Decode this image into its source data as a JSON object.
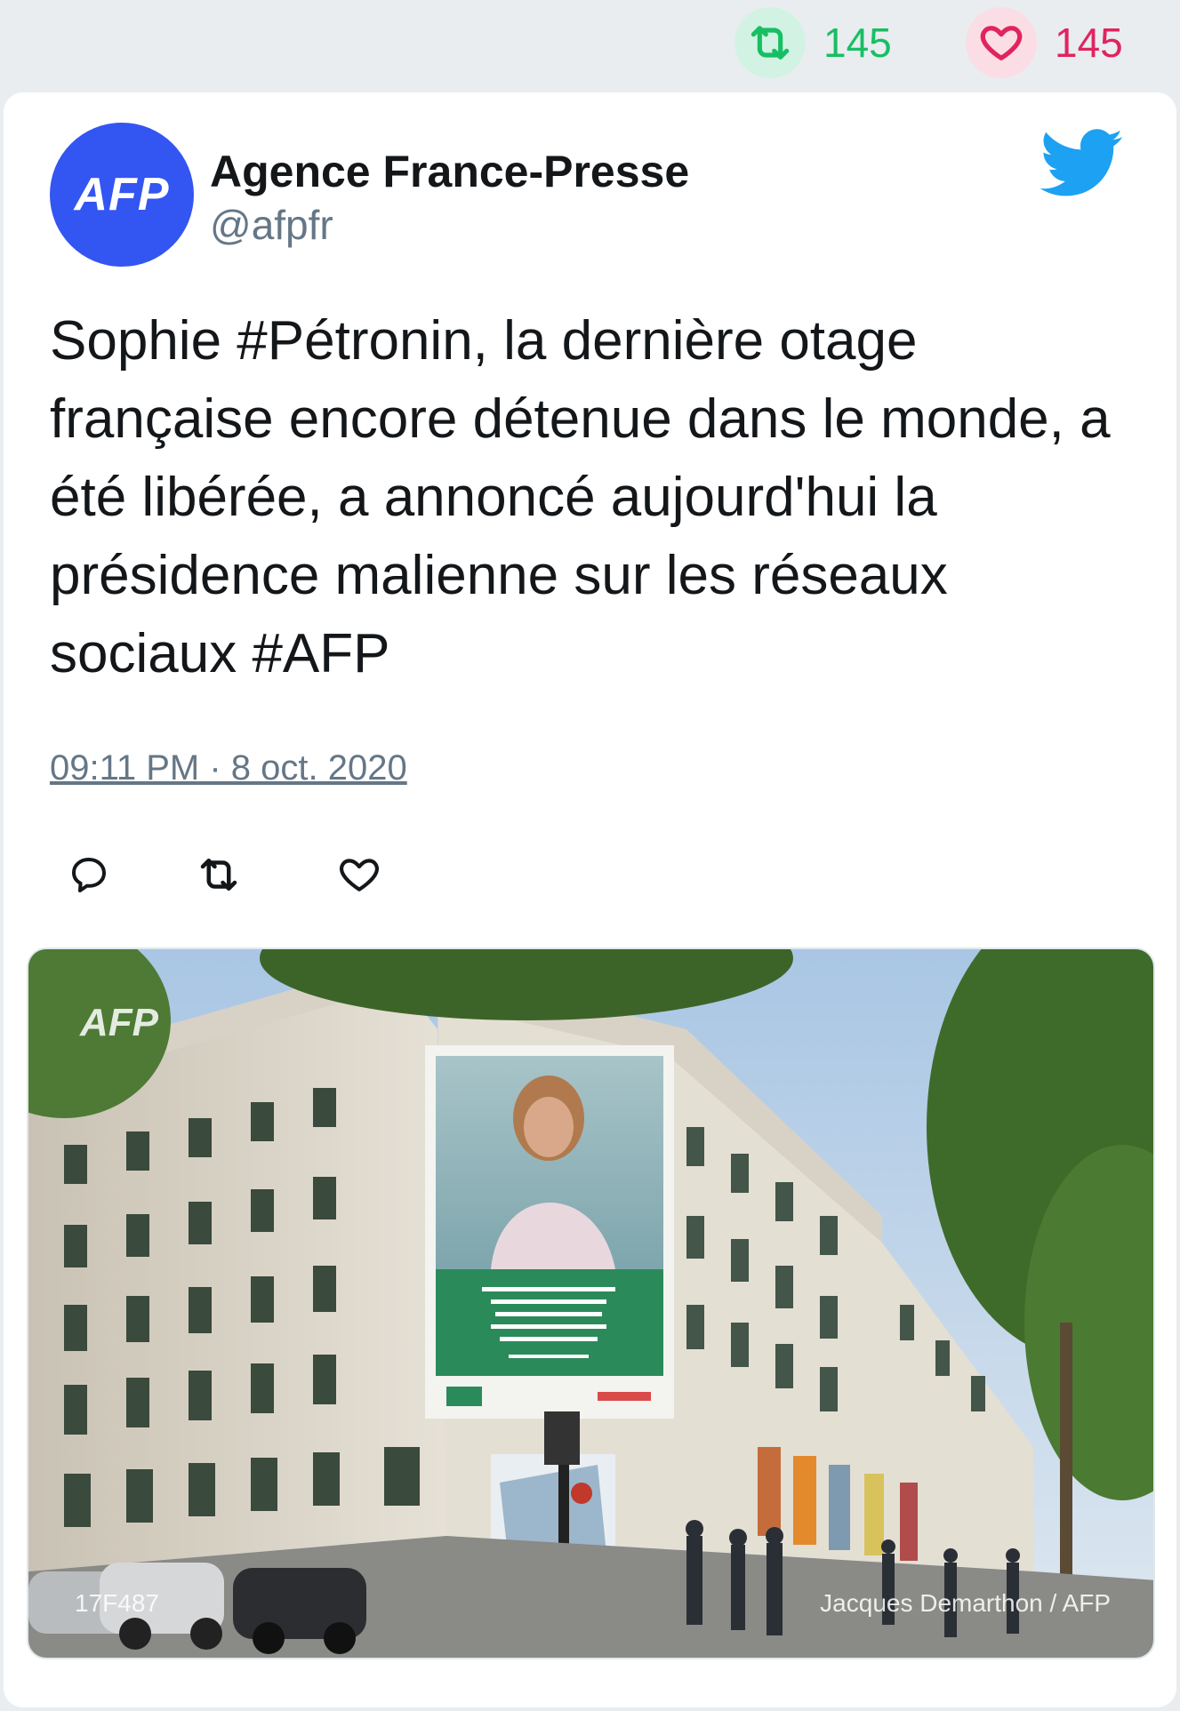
{
  "stats": {
    "retweets": "145",
    "likes": "145",
    "retweet_color": "#17bf63",
    "like_color": "#e0245e"
  },
  "author": {
    "avatar_text": "AFP",
    "name": "Agence France-Presse",
    "handle": "@afpfr",
    "avatar_color": "#3355f2"
  },
  "tweet": {
    "text": "Sophie #Pétronin, la dernière otage française encore détenue dans le monde, a été libérée, a annoncé aujourd'hui la présidence malienne sur les réseaux sociaux #AFP",
    "timestamp": "09:11 PM · 8 oct. 2020"
  },
  "actions": {
    "icons": [
      "reply-icon",
      "retweet-icon",
      "like-icon"
    ]
  },
  "media": {
    "watermark": "AFP",
    "photo_code": "17F487",
    "credit": "Jacques Demarthon / AFP"
  },
  "brand": {
    "twitter_color": "#1da1f2"
  }
}
